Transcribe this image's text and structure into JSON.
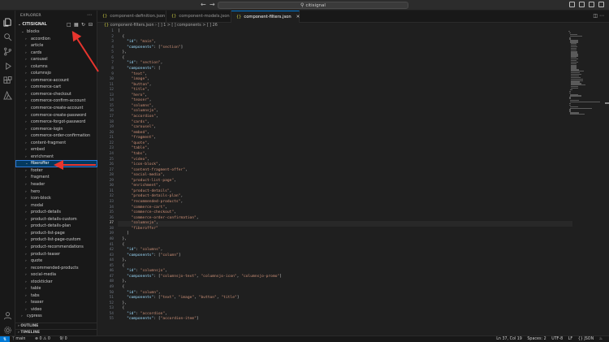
{
  "titlebar": {
    "search_text": "citisignal"
  },
  "sidebar": {
    "header": "EXPLORER",
    "root": "CITISIGNAL",
    "items": [
      {
        "label": "blocks",
        "open": true,
        "level": 0
      },
      {
        "label": "accordion",
        "level": 1
      },
      {
        "label": "article",
        "level": 1
      },
      {
        "label": "cards",
        "level": 1
      },
      {
        "label": "carousel",
        "level": 1
      },
      {
        "label": "columns",
        "level": 1
      },
      {
        "label": "columnsjo",
        "level": 1
      },
      {
        "label": "commerce-account",
        "level": 1
      },
      {
        "label": "commerce-cart",
        "level": 1
      },
      {
        "label": "commerce-checkout",
        "level": 1
      },
      {
        "label": "commerce-confirm-account",
        "level": 1
      },
      {
        "label": "commerce-create-account",
        "level": 1
      },
      {
        "label": "commerce-create-password",
        "level": 1
      },
      {
        "label": "commerce-forgot-password",
        "level": 1
      },
      {
        "label": "commerce-login",
        "level": 1
      },
      {
        "label": "commerce-order-confirmation",
        "level": 1
      },
      {
        "label": "content-fragment",
        "level": 1
      },
      {
        "label": "embed",
        "level": 1
      },
      {
        "label": "enrichment",
        "level": 1
      },
      {
        "label": "fiberoffer",
        "level": 1,
        "selected": true
      },
      {
        "label": "footer",
        "level": 1
      },
      {
        "label": "fragment",
        "level": 1
      },
      {
        "label": "header",
        "level": 1
      },
      {
        "label": "hero",
        "level": 1
      },
      {
        "label": "icon-block",
        "level": 1
      },
      {
        "label": "modal",
        "level": 1
      },
      {
        "label": "product-details",
        "level": 1
      },
      {
        "label": "product-details-custom",
        "level": 1
      },
      {
        "label": "product-details-plan",
        "level": 1
      },
      {
        "label": "product-list-page",
        "level": 1
      },
      {
        "label": "product-list-page-custom",
        "level": 1
      },
      {
        "label": "product-recommendations",
        "level": 1
      },
      {
        "label": "product-teaser",
        "level": 1
      },
      {
        "label": "quote",
        "level": 1
      },
      {
        "label": "recommended-products",
        "level": 1
      },
      {
        "label": "social-media",
        "level": 1
      },
      {
        "label": "stockticker",
        "level": 1
      },
      {
        "label": "table",
        "level": 1
      },
      {
        "label": "tabs",
        "level": 1
      },
      {
        "label": "teaser",
        "level": 1
      },
      {
        "label": "video",
        "level": 1
      },
      {
        "label": "cypress",
        "level": 0
      }
    ],
    "outline": "OUTLINE",
    "timeline": "TIMELINE"
  },
  "tabs": [
    {
      "label": "component-definition.json",
      "active": false
    },
    {
      "label": "component-models.json",
      "active": false
    },
    {
      "label": "component-filters.json",
      "active": true
    }
  ],
  "breadcrumb": {
    "file": "component-filters.json",
    "path": "[ ] 1 > [ ] components > [ ] 26"
  },
  "editor": {
    "current_line": 37,
    "lines": [
      "[",
      "  {",
      "    \"id\": \"main\",",
      "    \"components\": [\"section\"]",
      "  },",
      "  {",
      "    \"id\": \"section\",",
      "    \"components\": [",
      "      \"text\",",
      "      \"image\",",
      "      \"button\",",
      "      \"title\",",
      "      \"hero\",",
      "      \"teaser\",",
      "      \"columns\",",
      "      \"columnsjo\",",
      "      \"accordion\",",
      "      \"cards\",",
      "      \"carousel\",",
      "      \"embed\",",
      "      \"fragment\",",
      "      \"quote\",",
      "      \"table\",",
      "      \"tabs\",",
      "      \"video\",",
      "      \"icon-block\",",
      "      \"content-fragment-offer\",",
      "      \"social-media\",",
      "      \"product-list-page\",",
      "      \"enrichment\",",
      "      \"product-details\",",
      "      \"product-details-plan\",",
      "      \"recommended-products\",",
      "      \"commerce-cart\",",
      "      \"commerce-checkout\",",
      "      \"commerce-order-confirmation\",",
      "      \"columnsjo\",",
      "      \"fiberoffer\"",
      "    ]",
      "  },",
      "  {",
      "    \"id\": \"columns\",",
      "    \"components\": [\"column\"]",
      "  },",
      "  {",
      "    \"id\": \"columnsjo\",",
      "    \"components\": [\"columnsjo-text\", \"columnsjo-icon\", \"columnsjo-promo\"]",
      "  },",
      "  {",
      "    \"id\": \"column\",",
      "    \"components\": [\"text\", \"image\", \"button\", \"title\"]",
      "  },",
      "  {",
      "    \"id\": \"accordion\",",
      "    \"components\": [\"accordion-item\"]"
    ]
  },
  "status": {
    "branch": "main",
    "problems": "0 ⚠ 0",
    "sync": "9/ 0",
    "position": "Ln 37, Col 19",
    "spaces": "Spaces: 2",
    "encoding": "UTF-8",
    "eol": "LF",
    "language": "{} JSON"
  }
}
